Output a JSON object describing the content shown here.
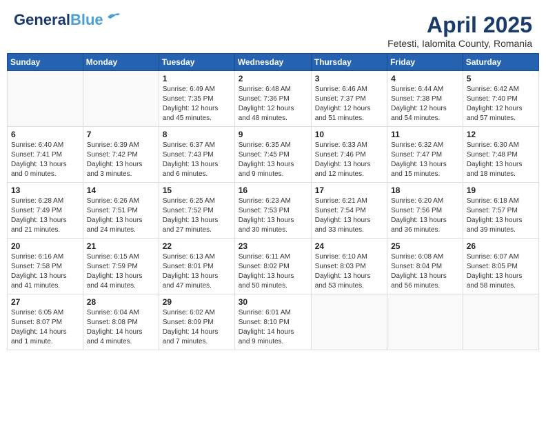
{
  "header": {
    "logo_general": "General",
    "logo_blue": "Blue",
    "month_year": "April 2025",
    "location": "Fetesti, Ialomita County, Romania"
  },
  "weekdays": [
    "Sunday",
    "Monday",
    "Tuesday",
    "Wednesday",
    "Thursday",
    "Friday",
    "Saturday"
  ],
  "weeks": [
    [
      {
        "day": "",
        "info": ""
      },
      {
        "day": "",
        "info": ""
      },
      {
        "day": "1",
        "info": "Sunrise: 6:49 AM\nSunset: 7:35 PM\nDaylight: 12 hours\nand 45 minutes."
      },
      {
        "day": "2",
        "info": "Sunrise: 6:48 AM\nSunset: 7:36 PM\nDaylight: 12 hours\nand 48 minutes."
      },
      {
        "day": "3",
        "info": "Sunrise: 6:46 AM\nSunset: 7:37 PM\nDaylight: 12 hours\nand 51 minutes."
      },
      {
        "day": "4",
        "info": "Sunrise: 6:44 AM\nSunset: 7:38 PM\nDaylight: 12 hours\nand 54 minutes."
      },
      {
        "day": "5",
        "info": "Sunrise: 6:42 AM\nSunset: 7:40 PM\nDaylight: 12 hours\nand 57 minutes."
      }
    ],
    [
      {
        "day": "6",
        "info": "Sunrise: 6:40 AM\nSunset: 7:41 PM\nDaylight: 13 hours\nand 0 minutes."
      },
      {
        "day": "7",
        "info": "Sunrise: 6:39 AM\nSunset: 7:42 PM\nDaylight: 13 hours\nand 3 minutes."
      },
      {
        "day": "8",
        "info": "Sunrise: 6:37 AM\nSunset: 7:43 PM\nDaylight: 13 hours\nand 6 minutes."
      },
      {
        "day": "9",
        "info": "Sunrise: 6:35 AM\nSunset: 7:45 PM\nDaylight: 13 hours\nand 9 minutes."
      },
      {
        "day": "10",
        "info": "Sunrise: 6:33 AM\nSunset: 7:46 PM\nDaylight: 13 hours\nand 12 minutes."
      },
      {
        "day": "11",
        "info": "Sunrise: 6:32 AM\nSunset: 7:47 PM\nDaylight: 13 hours\nand 15 minutes."
      },
      {
        "day": "12",
        "info": "Sunrise: 6:30 AM\nSunset: 7:48 PM\nDaylight: 13 hours\nand 18 minutes."
      }
    ],
    [
      {
        "day": "13",
        "info": "Sunrise: 6:28 AM\nSunset: 7:49 PM\nDaylight: 13 hours\nand 21 minutes."
      },
      {
        "day": "14",
        "info": "Sunrise: 6:26 AM\nSunset: 7:51 PM\nDaylight: 13 hours\nand 24 minutes."
      },
      {
        "day": "15",
        "info": "Sunrise: 6:25 AM\nSunset: 7:52 PM\nDaylight: 13 hours\nand 27 minutes."
      },
      {
        "day": "16",
        "info": "Sunrise: 6:23 AM\nSunset: 7:53 PM\nDaylight: 13 hours\nand 30 minutes."
      },
      {
        "day": "17",
        "info": "Sunrise: 6:21 AM\nSunset: 7:54 PM\nDaylight: 13 hours\nand 33 minutes."
      },
      {
        "day": "18",
        "info": "Sunrise: 6:20 AM\nSunset: 7:56 PM\nDaylight: 13 hours\nand 36 minutes."
      },
      {
        "day": "19",
        "info": "Sunrise: 6:18 AM\nSunset: 7:57 PM\nDaylight: 13 hours\nand 39 minutes."
      }
    ],
    [
      {
        "day": "20",
        "info": "Sunrise: 6:16 AM\nSunset: 7:58 PM\nDaylight: 13 hours\nand 41 minutes."
      },
      {
        "day": "21",
        "info": "Sunrise: 6:15 AM\nSunset: 7:59 PM\nDaylight: 13 hours\nand 44 minutes."
      },
      {
        "day": "22",
        "info": "Sunrise: 6:13 AM\nSunset: 8:01 PM\nDaylight: 13 hours\nand 47 minutes."
      },
      {
        "day": "23",
        "info": "Sunrise: 6:11 AM\nSunset: 8:02 PM\nDaylight: 13 hours\nand 50 minutes."
      },
      {
        "day": "24",
        "info": "Sunrise: 6:10 AM\nSunset: 8:03 PM\nDaylight: 13 hours\nand 53 minutes."
      },
      {
        "day": "25",
        "info": "Sunrise: 6:08 AM\nSunset: 8:04 PM\nDaylight: 13 hours\nand 56 minutes."
      },
      {
        "day": "26",
        "info": "Sunrise: 6:07 AM\nSunset: 8:05 PM\nDaylight: 13 hours\nand 58 minutes."
      }
    ],
    [
      {
        "day": "27",
        "info": "Sunrise: 6:05 AM\nSunset: 8:07 PM\nDaylight: 14 hours\nand 1 minute."
      },
      {
        "day": "28",
        "info": "Sunrise: 6:04 AM\nSunset: 8:08 PM\nDaylight: 14 hours\nand 4 minutes."
      },
      {
        "day": "29",
        "info": "Sunrise: 6:02 AM\nSunset: 8:09 PM\nDaylight: 14 hours\nand 7 minutes."
      },
      {
        "day": "30",
        "info": "Sunrise: 6:01 AM\nSunset: 8:10 PM\nDaylight: 14 hours\nand 9 minutes."
      },
      {
        "day": "",
        "info": ""
      },
      {
        "day": "",
        "info": ""
      },
      {
        "day": "",
        "info": ""
      }
    ]
  ]
}
